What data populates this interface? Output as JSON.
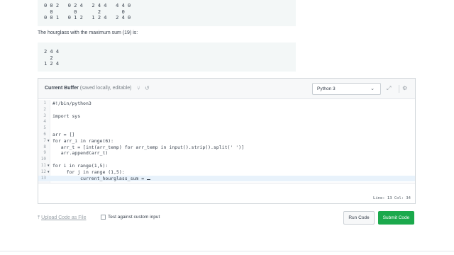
{
  "sample_output_top": {
    "lines": [
      "0 0 2   0 2 4   2 4 4   4 4 0",
      "  0       0       2       0",
      "0 0 1   0 1 2   1 2 4   2 4 0"
    ]
  },
  "description": "The hourglass with the maximum sum (19) is:",
  "sample_output_bottom": {
    "lines": [
      "2 4 4",
      "  2",
      "1 2 4"
    ]
  },
  "editor": {
    "title": "Current Buffer",
    "title_note": "(saved locally, editable)",
    "language": "Python 3",
    "code_lines": [
      {
        "n": "1",
        "text": "#!/bin/python3",
        "fold": ""
      },
      {
        "n": "2",
        "text": "",
        "fold": ""
      },
      {
        "n": "3",
        "text": "import sys",
        "fold": ""
      },
      {
        "n": "4",
        "text": "",
        "fold": ""
      },
      {
        "n": "5",
        "text": "",
        "fold": ""
      },
      {
        "n": "6",
        "text": "arr = []",
        "fold": ""
      },
      {
        "n": "7",
        "text": "for arr_i in range(6):",
        "fold": "▼"
      },
      {
        "n": "8",
        "text": "   arr_t = [int(arr_temp) for arr_temp in input().strip().split(' ')]",
        "fold": ""
      },
      {
        "n": "9",
        "text": "   arr.append(arr_t)",
        "fold": ""
      },
      {
        "n": "10",
        "text": "",
        "fold": ""
      },
      {
        "n": "11",
        "text": "for i in range(1,5):",
        "fold": "▼"
      },
      {
        "n": "12",
        "text": "     for j in range (1,5):",
        "fold": "▼"
      },
      {
        "n": "13",
        "text": "          current_hourglass_sum = ",
        "fold": ""
      }
    ],
    "status": "Line: 13 Col: 34"
  },
  "bottom": {
    "upload_label": "Upload Code as File",
    "custom_input_label": "Test against custom input",
    "run_label": "Run Code",
    "submit_label": "Submit Code"
  },
  "colors": {
    "submit": "#1ba94c",
    "active_line": "#e8f2fb"
  }
}
